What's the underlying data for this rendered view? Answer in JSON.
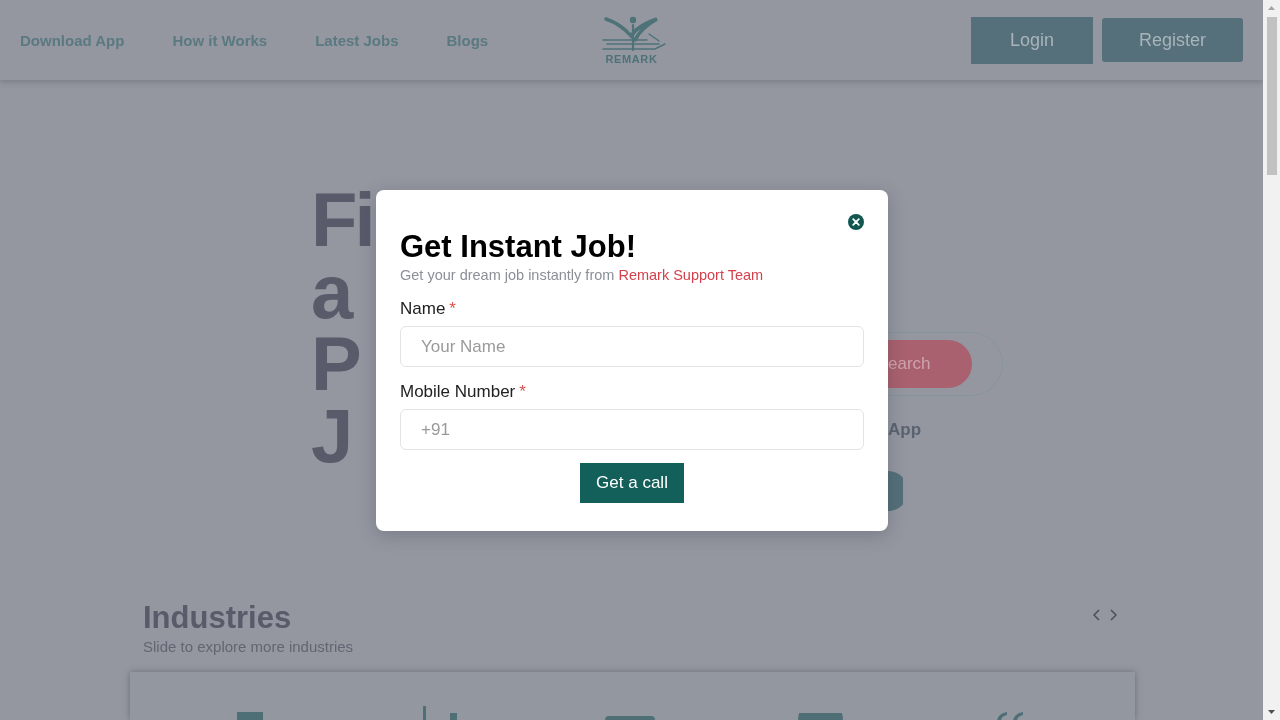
{
  "header": {
    "nav_links": [
      "Download App",
      "How it Works",
      "Latest Jobs",
      "Blogs"
    ],
    "logo": {
      "text": "REMARK"
    },
    "buttons": [
      {
        "label": "Login",
        "kind": "login"
      },
      {
        "label": "Register",
        "kind": "register"
      }
    ]
  },
  "hero": {
    "title_lines": [
      "Fi",
      "a",
      "P",
      "J"
    ],
    "search_button": "earch",
    "app_heading": "App"
  },
  "modal": {
    "title": "Get Instant Job!",
    "subtitle": "Get your dream job instantly from",
    "subtitle_highlight": "Remark Support Team",
    "fields": [
      {
        "label": "Name",
        "required_mark": "*",
        "placeholder": "Your Name"
      },
      {
        "label": "Mobile Number",
        "required_mark": "*",
        "placeholder": "+91"
      }
    ],
    "submit": "Get a call"
  },
  "industries": {
    "title": "Industries",
    "subtitle": "Slide to explore more industries"
  }
}
